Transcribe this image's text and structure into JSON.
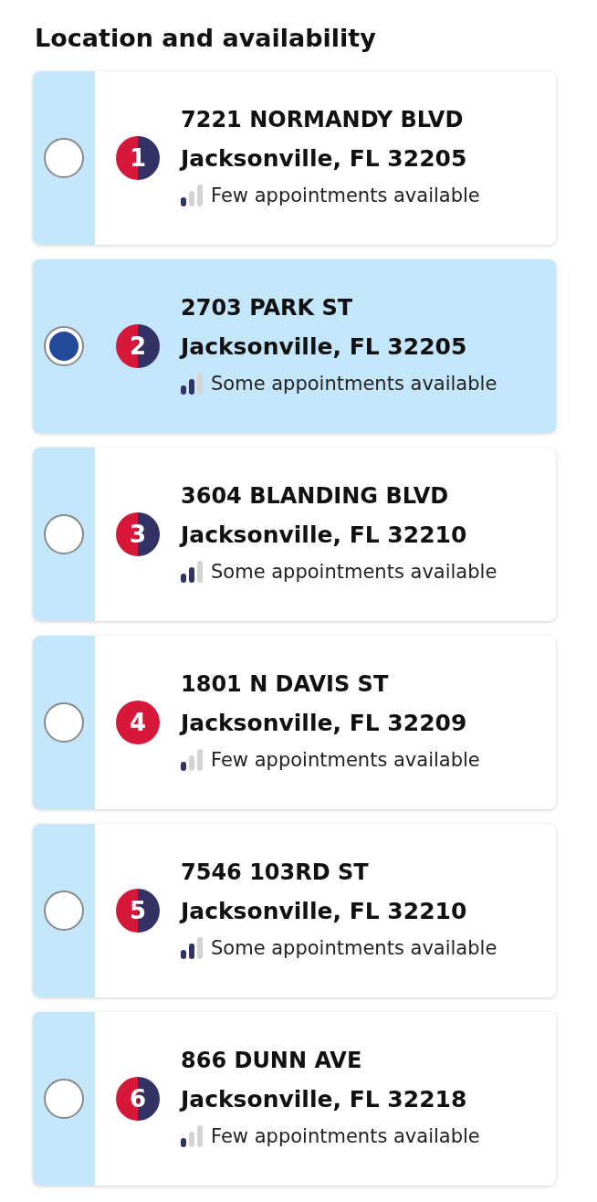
{
  "heading": "Location and availability",
  "locations": [
    {
      "street": "7221 NORMANDY BLVD",
      "city": "Jacksonville, FL 32205",
      "number": "1",
      "kind": "split",
      "availability": "Few appointments available",
      "level": 0.33,
      "selected": false
    },
    {
      "street": "2703 PARK ST",
      "city": "Jacksonville, FL 32205",
      "number": "2",
      "kind": "split",
      "availability": "Some appointments available",
      "level": 0.67,
      "selected": true
    },
    {
      "street": "3604 BLANDING BLVD",
      "city": "Jacksonville, FL 32210",
      "number": "3",
      "kind": "split",
      "availability": "Some appointments available",
      "level": 0.67,
      "selected": false
    },
    {
      "street": "1801 N DAVIS ST",
      "city": "Jacksonville, FL 32209",
      "number": "4",
      "kind": "solid",
      "availability": "Few appointments available",
      "level": 0.33,
      "selected": false
    },
    {
      "street": "7546 103RD ST",
      "city": "Jacksonville, FL 32210",
      "number": "5",
      "kind": "split",
      "availability": "Some appointments available",
      "level": 0.67,
      "selected": false
    },
    {
      "street": "866 DUNN AVE",
      "city": "Jacksonville, FL 32218",
      "number": "6",
      "kind": "split",
      "availability": "Few appointments available",
      "level": 0.33,
      "selected": false
    }
  ]
}
